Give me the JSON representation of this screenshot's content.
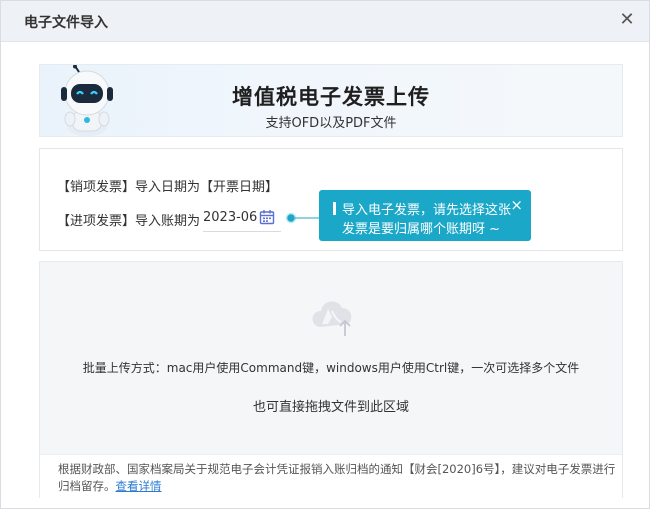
{
  "dialog": {
    "title": "电子文件导入",
    "close_icon": "close-icon"
  },
  "banner": {
    "title": "增值税电子发票上传",
    "subtitle": "支持OFD以及PDF文件",
    "mascot_icon": "robot-mascot"
  },
  "import_info": {
    "sales_line": "【销项发票】导入日期为【开票日期】",
    "purchase_label": "【进项发票】导入账期为",
    "period_value": "2023-06",
    "calendar_icon": "calendar-icon"
  },
  "tooltip": {
    "line1": "导入电子发票，请先选择这张",
    "line2": "发票是要归属哪个账期呀 ~",
    "close": "×",
    "accent": "#1ba7c8"
  },
  "dropzone": {
    "upload_icon": "cloud-upload-icon",
    "batch_text": "批量上传方式：mac用户使用Command键，windows用户使用Ctrl键，一次可选择多个文件",
    "drag_text": "也可直接拖拽文件到此区域"
  },
  "notice": {
    "line1": "根据财政部、国家档案局关于规范电子会计凭证报销入账归档的通知【财会[2020]6号】，建议对电子发票进行",
    "line2": "归档留存。",
    "link": "查看详情"
  }
}
